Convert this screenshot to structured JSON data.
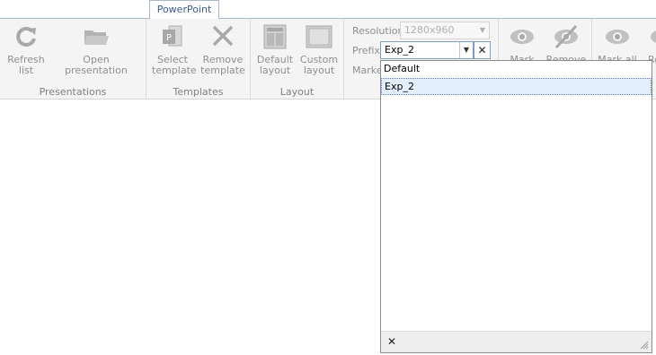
{
  "tab": {
    "label": "PowerPoint"
  },
  "groups": {
    "presentations": "Presentations",
    "templates": "Templates",
    "layout": "Layout"
  },
  "buttons": {
    "refresh_l1": "Refresh",
    "refresh_l2": "list",
    "open": "Open presentation",
    "select_l1": "Select",
    "select_l2": "template",
    "remove_l1": "Remove",
    "remove_l2": "template",
    "default_l1": "Default",
    "default_l2": "layout",
    "custom_l1": "Custom",
    "custom_l2": "layout",
    "mark": "Mark",
    "remove2": "Remove",
    "mark_all": "Mark all",
    "cut": "Re"
  },
  "fields": {
    "resolution_label": "Resolution",
    "resolution_value": "1280x960",
    "prefix_label": "Prefix",
    "prefix_value": "Exp_2",
    "marker_label": "Marke"
  },
  "dropdown": {
    "items": [
      "Default",
      "Exp_2"
    ],
    "selected": "Exp_2"
  },
  "icons": {
    "refresh": "refresh-icon",
    "folder": "folder-open-icon",
    "ppt": "powerpoint-template-icon",
    "remove": "close-icon",
    "default_layout": "default-layout-icon",
    "custom_layout": "custom-layout-icon",
    "eye": "eye-icon",
    "eye_off": "eye-off-icon"
  }
}
